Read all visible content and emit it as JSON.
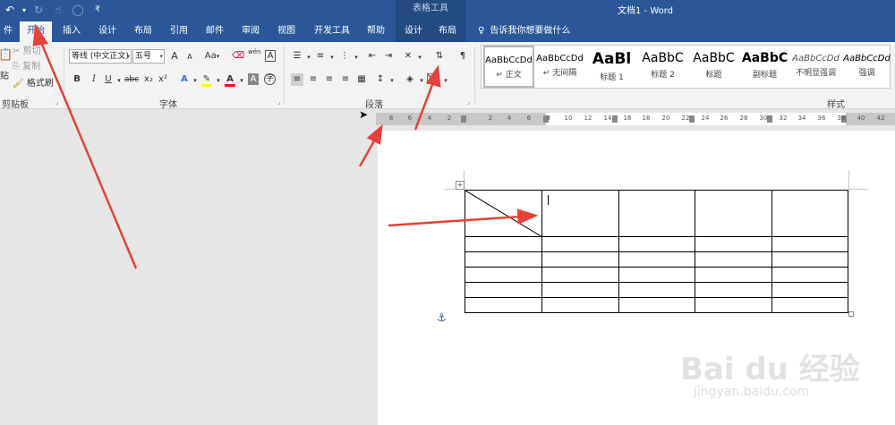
{
  "title_bar": {
    "contextual_tools": "表格工具",
    "document_title": "文档1  -  Word"
  },
  "tabs": {
    "file": "件",
    "home": "开始",
    "insert": "插入",
    "design": "设计",
    "layout": "布局",
    "references": "引用",
    "mailings": "邮件",
    "review": "审阅",
    "view": "视图",
    "developer": "开发工具",
    "help": "帮助",
    "table_design": "设计",
    "table_layout": "布局",
    "tell_me": "告诉我你想要做什么"
  },
  "clipboard": {
    "paste": "贴",
    "cut": "剪切",
    "copy": "复制",
    "format_painter": "格式刷",
    "label": "剪贴板"
  },
  "font": {
    "font_name": "等线 (中文正文)",
    "font_size": "五号",
    "label": "字体",
    "bold": "B",
    "italic": "I",
    "underline": "U",
    "strikethrough": "abc",
    "subscript": "x₂",
    "superscript": "x²",
    "grow": "A",
    "shrink": "A",
    "change_case": "Aa",
    "phonetic": "wén",
    "char_border": "A",
    "text_effect": "A",
    "font_color": "A",
    "char_shading": "A"
  },
  "paragraph": {
    "label": "段落"
  },
  "styles": {
    "label": "样式",
    "items": [
      {
        "preview": "AaBbCcDd",
        "name": "↵ 正文"
      },
      {
        "preview": "AaBbCcDd",
        "name": "↵ 无间隔"
      },
      {
        "preview": "AaBl",
        "name": "标题 1"
      },
      {
        "preview": "AaBbC",
        "name": "标题 2"
      },
      {
        "preview": "AaBbC",
        "name": "标题"
      },
      {
        "preview": "AaBbC",
        "name": "副标题"
      },
      {
        "preview": "AaBbCcDd",
        "name": "不明显强调"
      },
      {
        "preview": "AaBbCcDd",
        "name": "强调"
      }
    ]
  },
  "ruler": {
    "ticks": [
      "8",
      "6",
      "4",
      "2",
      "2",
      "4",
      "6",
      "8",
      "10",
      "12",
      "14",
      "16",
      "18",
      "20",
      "22",
      "24",
      "26",
      "28",
      "30",
      "32",
      "34",
      "36",
      "38",
      "40",
      "42"
    ]
  },
  "watermark": {
    "brand": "Bai du 经验",
    "url": "jingyan.baidu.com"
  },
  "colors": {
    "accent": "#2b579a",
    "annotation_arrow": "#e8413a",
    "font_color_bar": "#e02020",
    "highlight_bar": "#ffff00"
  }
}
